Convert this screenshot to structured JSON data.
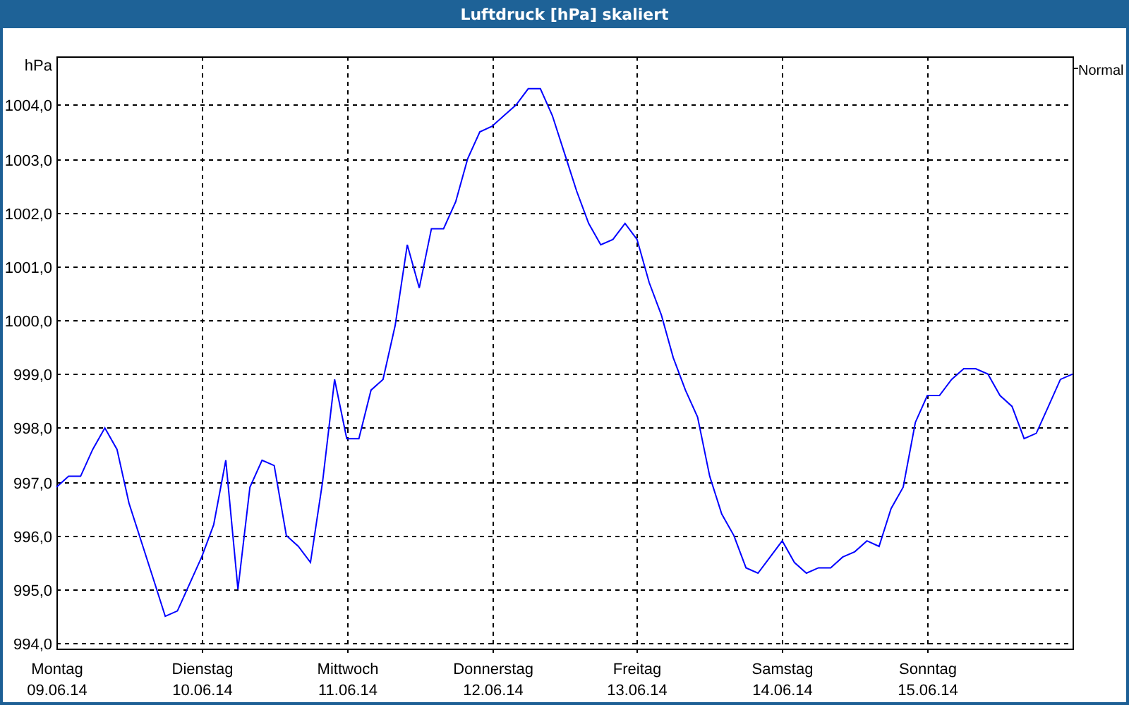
{
  "window": {
    "title": "Luftdruck [hPa] skaliert"
  },
  "chart": {
    "chart_data": {
      "type": "line",
      "grid": true,
      "ylabel": "hPa",
      "ylim": [
        993.9,
        1004.9
      ],
      "yticks": [
        {
          "value": 994,
          "label": "994,0"
        },
        {
          "value": 995,
          "label": "995,0"
        },
        {
          "value": 996,
          "label": "996,0"
        },
        {
          "value": 997,
          "label": "997,0"
        },
        {
          "value": 998,
          "label": "998,0"
        },
        {
          "value": 999,
          "label": "999,0"
        },
        {
          "value": 1000,
          "label": "1000,0"
        },
        {
          "value": 1001,
          "label": "1001,0"
        },
        {
          "value": 1002,
          "label": "1002,0"
        },
        {
          "value": 1003,
          "label": "1003,0"
        },
        {
          "value": 1004,
          "label": "1004,0"
        }
      ],
      "categories": [
        "Montag\n09.06.14",
        null,
        null,
        null,
        null,
        null,
        null,
        null,
        null,
        null,
        null,
        null,
        "Dienstag\n10.06.14",
        null,
        null,
        null,
        null,
        null,
        null,
        null,
        null,
        null,
        null,
        null,
        "Mittwoch\n11.06.14",
        null,
        null,
        null,
        null,
        null,
        null,
        null,
        null,
        null,
        null,
        null,
        "Donnerstag\n12.06.14",
        null,
        null,
        null,
        null,
        null,
        null,
        null,
        null,
        null,
        null,
        null,
        "Freitag\n13.06.14",
        null,
        null,
        null,
        null,
        null,
        null,
        null,
        null,
        null,
        null,
        null,
        "Samstag\n14.06.14",
        null,
        null,
        null,
        null,
        null,
        null,
        null,
        null,
        null,
        null,
        null,
        "Sonntag\n15.06.14",
        null,
        null,
        null,
        null,
        null,
        null,
        null,
        null,
        null,
        null,
        null,
        null
      ],
      "series": [
        {
          "name": "Normal",
          "color": "#0000ff",
          "values": [
            996.9,
            997.1,
            997.1,
            997.6,
            998.0,
            997.6,
            996.6,
            995.9,
            995.2,
            994.5,
            994.6,
            995.1,
            995.6,
            996.2,
            997.4,
            995.0,
            996.9,
            997.4,
            997.3,
            996.0,
            995.8,
            995.5,
            997.0,
            998.9,
            997.8,
            997.8,
            998.7,
            998.9,
            999.9,
            1001.4,
            1000.6,
            1001.7,
            1001.7,
            1002.2,
            1003.0,
            1003.5,
            1003.6,
            1003.8,
            1004.0,
            1004.3,
            1004.3,
            1003.8,
            1003.1,
            1002.4,
            1001.8,
            1001.4,
            1001.5,
            1001.8,
            1001.5,
            1000.7,
            1000.1,
            999.3,
            998.7,
            998.2,
            997.1,
            996.4,
            996.0,
            995.4,
            995.3,
            995.6,
            995.9,
            995.5,
            995.3,
            995.4,
            995.4,
            995.6,
            995.7,
            995.9,
            995.8,
            996.5,
            996.9,
            998.1,
            998.6,
            998.6,
            998.9,
            999.1,
            999.1,
            999.0,
            998.6,
            998.4,
            997.8,
            997.9,
            998.4,
            998.9,
            999.0
          ]
        }
      ]
    }
  }
}
